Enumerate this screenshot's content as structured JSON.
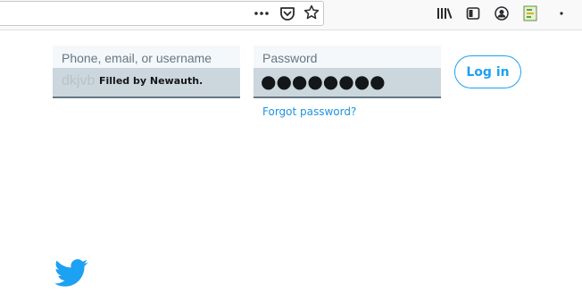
{
  "browser": {
    "toolbar_icons": [
      "more-actions-icon",
      "pocket-icon",
      "bookmark-star-icon",
      "library-icon",
      "sidebar-icon",
      "account-icon",
      "extension-icon"
    ]
  },
  "login": {
    "username_label": "Phone, email, or username",
    "username_ghost": "dkjvb",
    "autofill_badge": "Filled by Newauth.",
    "password_label": "Password",
    "password_mask": "●●●●●●●●",
    "forgot_link": "Forgot password?",
    "login_button": "Log in"
  },
  "colors": {
    "accent": "#1da1f2",
    "link": "#1b95e0",
    "autofill_bg": "#ccd6dd",
    "field_bg": "#f5f8fa"
  },
  "footer": {
    "logo": "twitter-bird-icon"
  }
}
